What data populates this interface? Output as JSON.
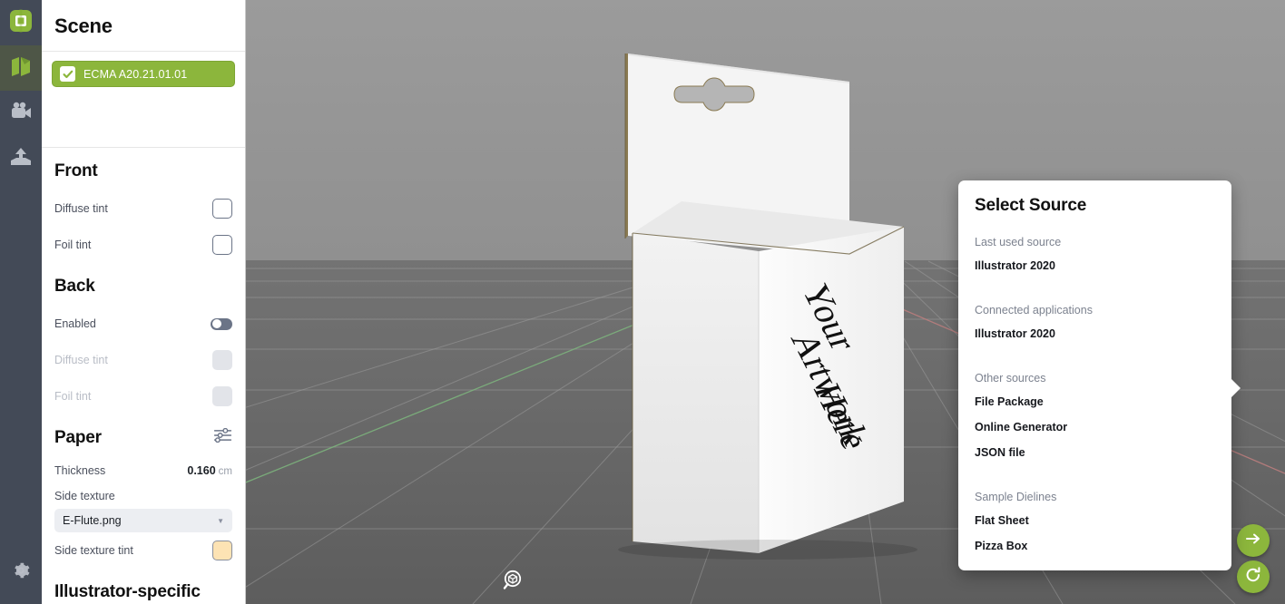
{
  "rail": {
    "items": [
      {
        "name": "app-logo",
        "icon": "app-logo-icon",
        "active": false
      },
      {
        "name": "dieline",
        "icon": "dieline-icon",
        "active": true
      },
      {
        "name": "camera",
        "icon": "camera-icon",
        "active": false
      },
      {
        "name": "export",
        "icon": "export-icon",
        "active": false
      }
    ],
    "settings": {
      "name": "settings",
      "icon": "gear-icon"
    }
  },
  "panel": {
    "title": "Scene",
    "scene_items": [
      {
        "label": "ECMA A20.21.01.01",
        "checked": true
      }
    ],
    "front": {
      "heading": "Front",
      "rows": [
        {
          "label": "Diffuse tint",
          "control": "swatch",
          "disabled": false
        },
        {
          "label": "Foil tint",
          "control": "swatch",
          "disabled": false
        }
      ]
    },
    "back": {
      "heading": "Back",
      "enabled_label": "Enabled",
      "enabled": false,
      "rows": [
        {
          "label": "Diffuse tint",
          "control": "swatch",
          "disabled": true
        },
        {
          "label": "Foil tint",
          "control": "swatch",
          "disabled": true
        }
      ]
    },
    "paper": {
      "heading": "Paper",
      "settings_icon": "sliders-icon",
      "thickness_label": "Thickness",
      "thickness_value": "0.160",
      "thickness_unit": "cm",
      "side_texture_label": "Side texture",
      "side_texture_value": "E-Flute.png",
      "side_texture_tint_label": "Side texture tint",
      "side_texture_tint_color": "#fde3b4"
    },
    "illustrator": {
      "heading": "Illustrator-specific"
    }
  },
  "viewport": {
    "artwork_text_line1": "Your",
    "artwork_text_line2": "Artwork",
    "artwork_text_line3": "Here",
    "focus_icon": "focus-object-icon"
  },
  "fabs": [
    {
      "name": "next-button",
      "icon": "arrow-right-icon"
    },
    {
      "name": "reload-button",
      "icon": "reload-icon"
    }
  ],
  "dialog": {
    "title": "Select Source",
    "groups": [
      {
        "label": "Last used source",
        "items": [
          "Illustrator 2020"
        ]
      },
      {
        "label": "Connected applications",
        "items": [
          "Illustrator 2020"
        ]
      },
      {
        "label": "Other sources",
        "items": [
          "File Package",
          "Online Generator",
          "JSON file"
        ]
      },
      {
        "label": "Sample Dielines",
        "items": [
          "Flat Sheet",
          "Pizza Box"
        ]
      }
    ]
  },
  "colors": {
    "accent_green": "#8cb63c",
    "rail_bg": "#434a57",
    "rail_active": "#4e5647"
  }
}
